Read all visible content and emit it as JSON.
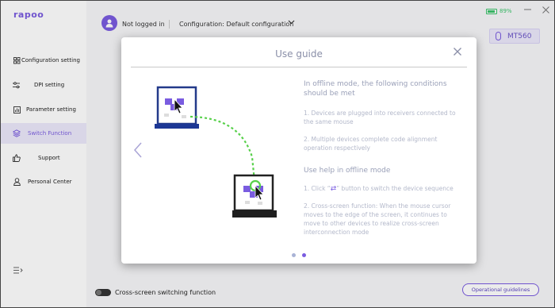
{
  "app": {
    "logo": "rapoo",
    "battery_pct": "89%",
    "battery_level": 0.89,
    "accent_color": "#7a5ce0",
    "battery_color": "#3bc46b"
  },
  "topbar": {
    "login_status": "Not logged in",
    "configuration": "Configuration: Default configuration"
  },
  "device": {
    "name": "MT560"
  },
  "sidebar": {
    "items": [
      {
        "label": "Configuration setting",
        "icon": "grid-icon"
      },
      {
        "label": "DPI setting",
        "icon": "dpi-icon"
      },
      {
        "label": "Parameter setting",
        "icon": "chart-icon"
      },
      {
        "label": "Switch Function",
        "icon": "layers-icon",
        "active": true
      },
      {
        "label": "Support",
        "icon": "thumbs-up-icon"
      },
      {
        "label": "Personal Center",
        "icon": "person-icon"
      }
    ]
  },
  "footer": {
    "toggle_label": "Cross-screen switching function",
    "toggle_on": false,
    "guide_button": "Operational guidelines"
  },
  "modal": {
    "title": "Use guide",
    "section1_title": "In offline mode, the following conditions should be met",
    "condition1": "1. Devices are plugged into receivers connected to the same mouse",
    "condition2": "2. Multiple devices complete code alignment operation respectively",
    "section2_title": "Use help in offline mode",
    "help1_prefix": "1. Click “",
    "help1_suffix": "” button to switch the device sequence",
    "help2": "2. Cross-screen function: When the mouse cursor moves to the edge of the screen, it continues to move to other devices to realize cross-screen interconnection mode",
    "page_count": 2,
    "current_page": 2
  }
}
